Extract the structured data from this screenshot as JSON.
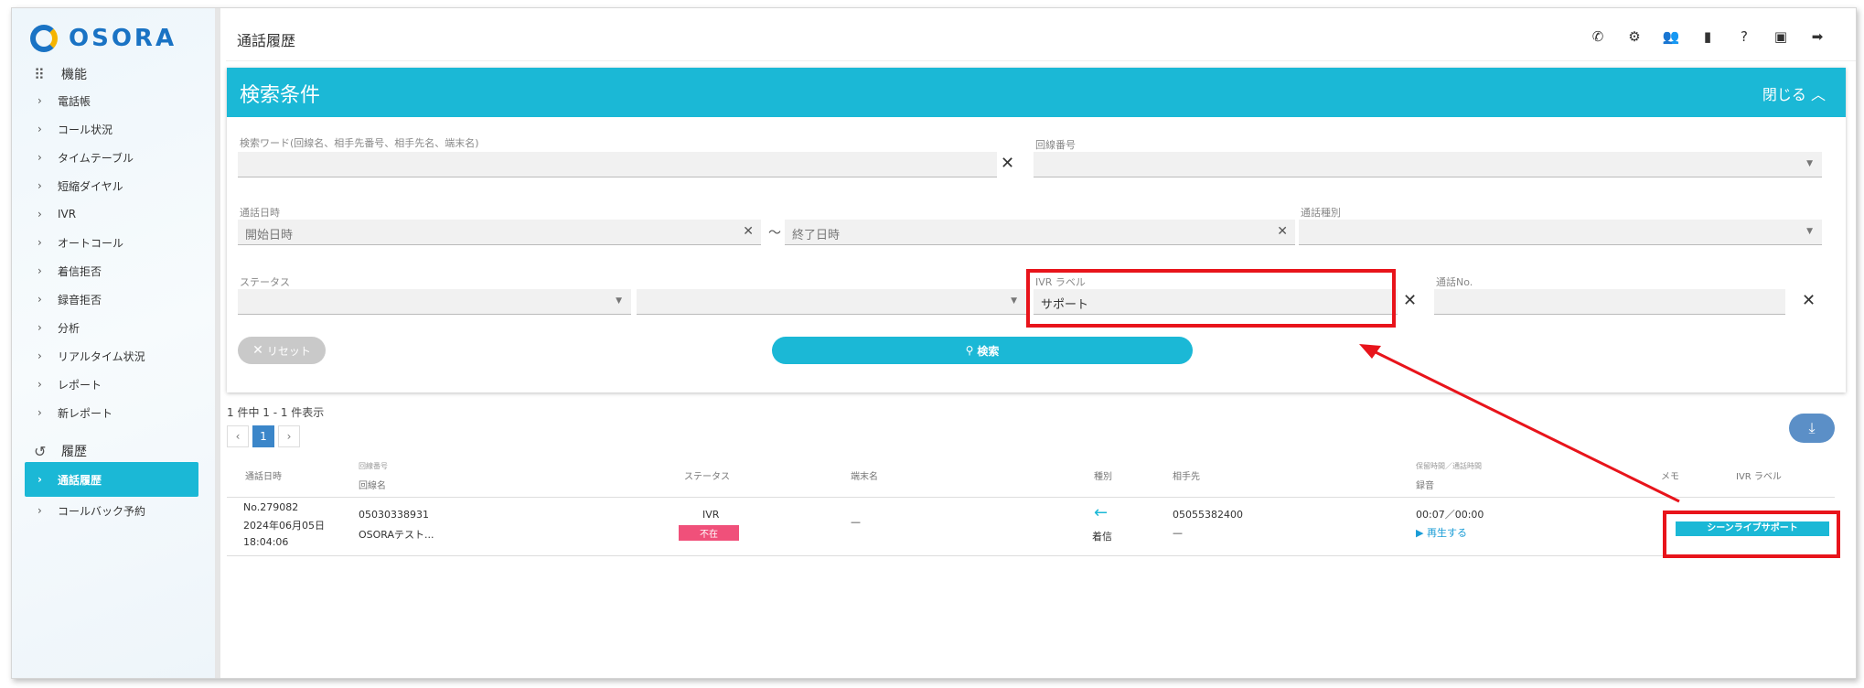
{
  "app": {
    "logo_text": "OSORA",
    "page_title": "通話履歴"
  },
  "sidebar": {
    "section_features": "機能",
    "features": [
      "電話帳",
      "コール状況",
      "タイムテーブル",
      "短縮ダイヤル",
      "IVR",
      "オートコール",
      "着信拒否",
      "録音拒否",
      "分析",
      "リアルタイム状況",
      "レポート",
      "新レポート"
    ],
    "section_history": "履歴",
    "history": [
      "通話履歴",
      "コールバック予約"
    ]
  },
  "top_icons": [
    "phone-settings-icon",
    "settings-icon",
    "users-icon",
    "book-icon",
    "help-icon",
    "account-icon",
    "logout-icon"
  ],
  "search": {
    "title": "検索条件",
    "close_label": "閉じる",
    "keyword_label": "検索ワード(回線名、相手先番号、相手先名、端末名)",
    "keyword_value": "",
    "line_number_label": "回線番号",
    "call_date_label": "通話日時",
    "start_placeholder": "開始日時",
    "end_placeholder": "終了日時",
    "tilde": "〜",
    "call_type_label": "通話種別",
    "status_label": "ステータス",
    "ivr_label_label": "IVR ラベル",
    "ivr_label_value": "サポート",
    "call_no_label": "通話No.",
    "reset_label": "リセット",
    "search_label": "検索"
  },
  "results": {
    "count_text": "1 件中 1 - 1 件表示",
    "pager": {
      "prev": "‹",
      "current": "1",
      "next": "›"
    },
    "headers": {
      "date": "通話日時",
      "line_number": "回線番号",
      "line_name": "回線名",
      "status": "ステータス",
      "terminal": "端末名",
      "type": "種別",
      "partner": "相手先",
      "duration_small": "保留時間／通話時間",
      "recording": "録音",
      "memo": "メモ",
      "ivr_label": "IVR ラベル"
    },
    "row": {
      "no": "No.279082",
      "date": "2024年06月05日",
      "time": "18:04:06",
      "line_number": "05030338931",
      "line_name": "OSORAテスト...",
      "status_top": "IVR",
      "status_badge": "不在",
      "terminal": "—",
      "type": "着信",
      "partner_number": "05055382400",
      "partner_name": "—",
      "duration": "00:07／00:00",
      "play": "再生する",
      "ivr_label": "シーンライブサポート"
    }
  },
  "colors": {
    "accent": "#1bb8d6",
    "highlight": "#e8141b",
    "badge_red": "#f0507a",
    "brand": "#1a73c4"
  }
}
